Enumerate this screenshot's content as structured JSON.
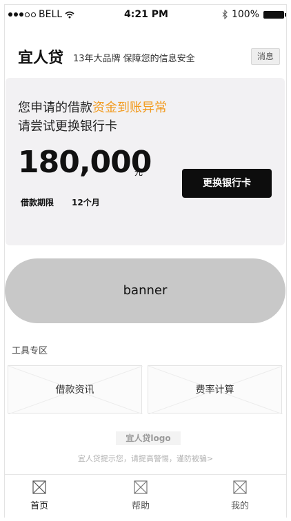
{
  "status_bar": {
    "carrier": "BELL",
    "time": "4:21 PM",
    "battery": "100%"
  },
  "header": {
    "logo": "宜人贷",
    "slogan": "13年大品牌  保障您的信息安全",
    "message_button": "消息"
  },
  "loan_card": {
    "line1_prefix": "您申请的借款",
    "line1_warning": "资金到账异常",
    "line2": "请尝试更换银行卡",
    "amount": "180,000",
    "unit": "元",
    "term_label": "借款期限",
    "term_value": "12个月",
    "change_card_button": "更换银行卡",
    "warning_color": "#f29a1d"
  },
  "banner": {
    "label": "banner"
  },
  "tools": {
    "title": "工具专区",
    "items": [
      {
        "label": "借款资讯"
      },
      {
        "label": "费率计算"
      }
    ]
  },
  "footer": {
    "logo": "宜人贷logo",
    "tip": "宜人贷提示您，请提高警惕，谨防被骗>"
  },
  "tab_bar": {
    "tabs": [
      {
        "label": "首页",
        "icon": "placeholder-icon",
        "active": true
      },
      {
        "label": "帮助",
        "icon": "placeholder-icon",
        "active": false
      },
      {
        "label": "我的",
        "icon": "placeholder-icon",
        "active": false
      }
    ]
  }
}
